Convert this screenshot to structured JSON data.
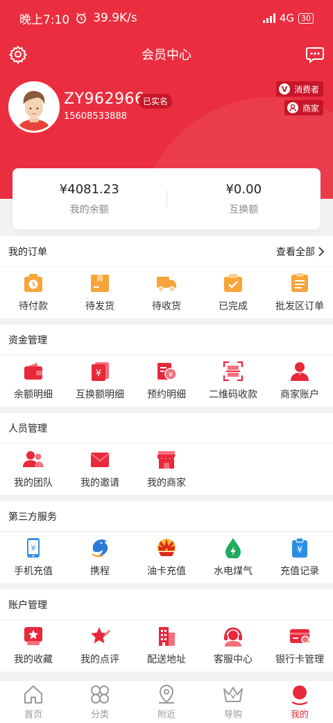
{
  "status_bar": {
    "time": "晚上7:10",
    "speed": "39.9K/s",
    "network": "4G",
    "battery": "30"
  },
  "header": {
    "title": "会员中心",
    "username": "ZY962966",
    "verified_badge": "已实名",
    "phone": "15608533888",
    "roles": [
      {
        "label": "消费者",
        "icon": "v-icon"
      },
      {
        "label": "商家",
        "icon": "merchant-icon"
      }
    ]
  },
  "balance": {
    "my_balance_amount": "¥4081.23",
    "my_balance_label": "我的余额",
    "exchange_amount": "¥0.00",
    "exchange_label": "互换额"
  },
  "orders": {
    "title": "我的订单",
    "view_all": "查看全部",
    "items": [
      {
        "label": "待付款",
        "icon": "clock-bag-icon"
      },
      {
        "label": "待发货",
        "icon": "package-icon"
      },
      {
        "label": "待收货",
        "icon": "truck-icon"
      },
      {
        "label": "已完成",
        "icon": "check-bag-icon"
      },
      {
        "label": "批发区订单",
        "icon": "list-icon"
      }
    ]
  },
  "funds": {
    "title": "资金管理",
    "items": [
      {
        "label": "余额明细",
        "icon": "wallet-icon"
      },
      {
        "label": "互换额明细",
        "icon": "yuan-card-icon"
      },
      {
        "label": "预约明细",
        "icon": "reserve-icon"
      },
      {
        "label": "二维码收款",
        "icon": "qr-scan-icon"
      },
      {
        "label": "商家账户",
        "icon": "user-icon"
      }
    ]
  },
  "people": {
    "title": "人员管理",
    "items": [
      {
        "label": "我的团队",
        "icon": "team-icon"
      },
      {
        "label": "我的邀请",
        "icon": "mail-icon"
      },
      {
        "label": "我的商家",
        "icon": "shop-icon"
      }
    ]
  },
  "third_party": {
    "title": "第三方服务",
    "items": [
      {
        "label": "手机充值",
        "icon": "phone-yuan-icon"
      },
      {
        "label": "携程",
        "icon": "dolphin-icon"
      },
      {
        "label": "油卡充值",
        "icon": "petrochina-icon"
      },
      {
        "label": "水电煤气",
        "icon": "drop-bolt-icon"
      },
      {
        "label": "充值记录",
        "icon": "recharge-record-icon"
      }
    ]
  },
  "account": {
    "title": "账户管理",
    "items": [
      {
        "label": "我的收藏",
        "icon": "favorite-icon"
      },
      {
        "label": "我的点评",
        "icon": "review-star-icon"
      },
      {
        "label": "配送地址",
        "icon": "building-icon"
      },
      {
        "label": "客服中心",
        "icon": "service-icon"
      },
      {
        "label": "银行卡管理",
        "icon": "bank-card-icon"
      }
    ]
  },
  "tabbar": {
    "items": [
      {
        "label": "首页",
        "icon": "home-icon"
      },
      {
        "label": "分类",
        "icon": "category-icon"
      },
      {
        "label": "附近",
        "icon": "location-icon"
      },
      {
        "label": "导购",
        "icon": "crown-icon"
      },
      {
        "label": "我的",
        "icon": "me-icon",
        "active": true
      }
    ]
  },
  "colors": {
    "brand_red": "#ea2e3f",
    "icon_orange": "#f7a43a",
    "icon_red": "#e8283b",
    "active_tab": "#e8283b"
  }
}
